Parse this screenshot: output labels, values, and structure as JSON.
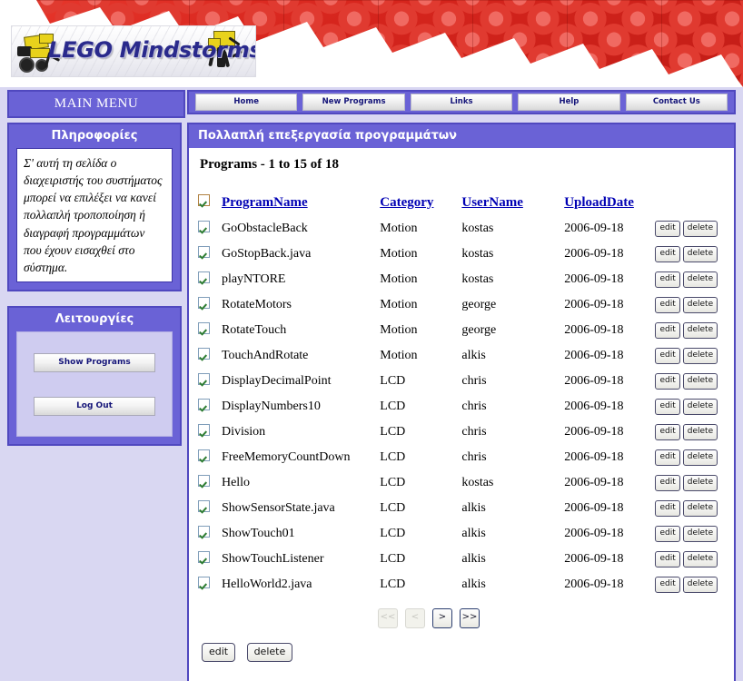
{
  "banner": {
    "logo_text": "LEGO Mindstorms",
    "brick_color": "#d6251d",
    "accent_color": "#6a62d6"
  },
  "menu": {
    "title": "MAIN MENU",
    "nav_items": [
      {
        "label": "Home"
      },
      {
        "label": "New Programs"
      },
      {
        "label": "Links"
      },
      {
        "label": "Help"
      },
      {
        "label": "Contact Us"
      }
    ]
  },
  "sidebar": {
    "info_box": {
      "title": "Πληροφορίες",
      "text": "Σ' αυτή τη σελίδα ο διαχειριστής του συστήματος μπορεί να επιλέξει να κανεί πολλαπλή τροποποίηση ή διαγραφή προγραμμάτων που έχουν εισαχθεί στο σύστημα."
    },
    "actions_box": {
      "title": "Λειτουργίες",
      "buttons": [
        {
          "label": "Show Programs"
        },
        {
          "label": "Log Out"
        }
      ]
    }
  },
  "content": {
    "title": "Πολλαπλή επεξεργασία προγραμμάτων",
    "programs_count": "Programs - 1 to 15 of 18",
    "columns": [
      {
        "label": "ProgramName"
      },
      {
        "label": "Category"
      },
      {
        "label": "UserName"
      },
      {
        "label": "UploadDate"
      }
    ],
    "row_actions": {
      "edit": "edit",
      "delete": "delete"
    },
    "rows": [
      {
        "checked": true,
        "name": "GoObstacleBack",
        "category": "Motion",
        "user": "kostas",
        "date": "2006-09-18"
      },
      {
        "checked": true,
        "name": "GoStopBack.java",
        "category": "Motion",
        "user": "kostas",
        "date": "2006-09-18"
      },
      {
        "checked": true,
        "name": "playNTORE",
        "category": "Motion",
        "user": "kostas",
        "date": "2006-09-18"
      },
      {
        "checked": true,
        "name": "RotateMotors",
        "category": "Motion",
        "user": "george",
        "date": "2006-09-18"
      },
      {
        "checked": true,
        "name": "RotateTouch",
        "category": "Motion",
        "user": "george",
        "date": "2006-09-18"
      },
      {
        "checked": true,
        "name": "TouchAndRotate",
        "category": "Motion",
        "user": "alkis",
        "date": "2006-09-18"
      },
      {
        "checked": true,
        "name": "DisplayDecimalPoint",
        "category": "LCD",
        "user": "chris",
        "date": "2006-09-18"
      },
      {
        "checked": true,
        "name": "DisplayNumbers10",
        "category": "LCD",
        "user": "chris",
        "date": "2006-09-18"
      },
      {
        "checked": true,
        "name": "Division",
        "category": "LCD",
        "user": "chris",
        "date": "2006-09-18"
      },
      {
        "checked": true,
        "name": "FreeMemoryCountDown",
        "category": "LCD",
        "user": "chris",
        "date": "2006-09-18"
      },
      {
        "checked": true,
        "name": "Hello",
        "category": "LCD",
        "user": "kostas",
        "date": "2006-09-18"
      },
      {
        "checked": true,
        "name": "ShowSensorState.java",
        "category": "LCD",
        "user": "alkis",
        "date": "2006-09-18"
      },
      {
        "checked": true,
        "name": "ShowTouch01",
        "category": "LCD",
        "user": "alkis",
        "date": "2006-09-18"
      },
      {
        "checked": true,
        "name": "ShowTouchListener",
        "category": "LCD",
        "user": "alkis",
        "date": "2006-09-18"
      },
      {
        "checked": true,
        "name": "HelloWorld2.java",
        "category": "LCD",
        "user": "alkis",
        "date": "2006-09-18"
      }
    ],
    "pagination": [
      {
        "label": "<<",
        "enabled": false
      },
      {
        "label": "<",
        "enabled": false
      },
      {
        "label": ">",
        "enabled": true
      },
      {
        "label": ">>",
        "enabled": true
      }
    ],
    "bottom_actions": [
      {
        "label": "edit"
      },
      {
        "label": "delete"
      }
    ]
  }
}
